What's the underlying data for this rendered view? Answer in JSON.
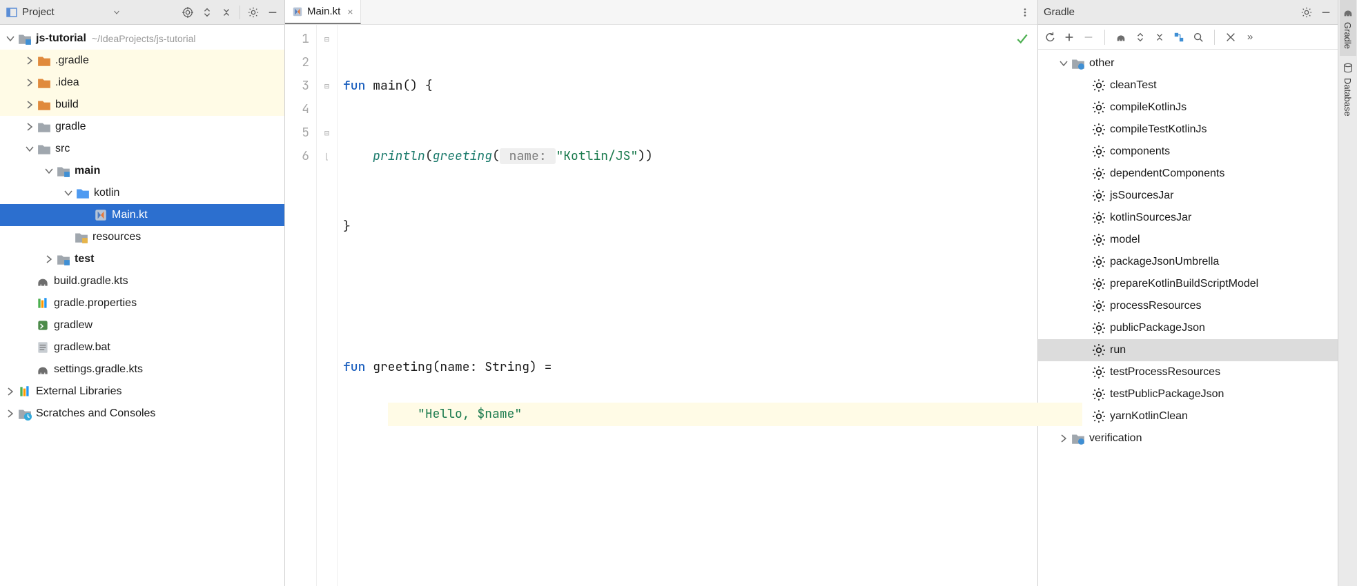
{
  "project_panel": {
    "title": "Project",
    "tree": {
      "root": {
        "label": "js-tutorial",
        "hint": "~/IdeaProjects/js-tutorial"
      },
      "items": [
        {
          "label": ".gradle"
        },
        {
          "label": ".idea"
        },
        {
          "label": "build"
        },
        {
          "label": "gradle"
        }
      ],
      "src": {
        "label": "src",
        "main": {
          "label": "main",
          "kotlin": {
            "label": "kotlin",
            "file": "Main.kt"
          },
          "resources": {
            "label": "resources"
          }
        },
        "test": {
          "label": "test"
        }
      },
      "root_files": [
        {
          "label": "build.gradle.kts"
        },
        {
          "label": "gradle.properties"
        },
        {
          "label": "gradlew"
        },
        {
          "label": "gradlew.bat"
        },
        {
          "label": "settings.gradle.kts"
        }
      ],
      "external": {
        "label": "External Libraries"
      },
      "scratches": {
        "label": "Scratches and Consoles"
      }
    }
  },
  "editor": {
    "tab_label": "Main.kt",
    "line_numbers": [
      "1",
      "2",
      "3",
      "4",
      "5",
      "6"
    ],
    "code": {
      "l1_fun": "fun",
      "l1_main": " main() {",
      "l2_indent": "    ",
      "l2_fn1": "println",
      "l2_open": "(",
      "l2_fn2": "greeting",
      "l2_open2": "(",
      "l2_hint": " name: ",
      "l2_str": "\"Kotlin/JS\"",
      "l2_close": "))",
      "l3": "}",
      "l5_fun": "fun",
      "l5_rest": " greeting(name: String) =",
      "l6_indent": "    ",
      "l6_str": "\"Hello, $name\""
    }
  },
  "gradle_panel": {
    "title": "Gradle",
    "groups": {
      "other": "other",
      "verification": "verification"
    },
    "tasks": [
      "cleanTest",
      "compileKotlinJs",
      "compileTestKotlinJs",
      "components",
      "dependentComponents",
      "jsSourcesJar",
      "kotlinSourcesJar",
      "model",
      "packageJsonUmbrella",
      "prepareKotlinBuildScriptModel",
      "processResources",
      "publicPackageJson",
      "run",
      "testProcessResources",
      "testPublicPackageJson",
      "yarnKotlinClean"
    ],
    "selected_task_index": 12
  },
  "tool_strip": {
    "gradle": "Gradle",
    "database": "Database"
  }
}
